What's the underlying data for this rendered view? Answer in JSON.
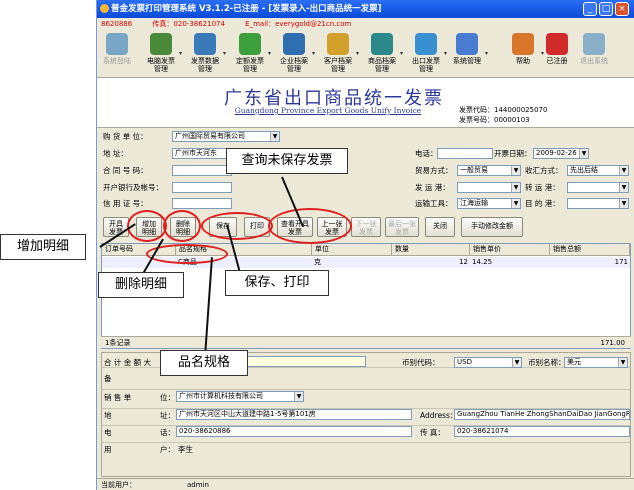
{
  "window": {
    "title": "普金发票打印管理系统 V3.1.2-已注册 - [发票录入-出口商品统一发票]",
    "info_phone": "8620886",
    "info_fax": "传真：020-38621074",
    "info_email": "E_mail：everygold@21cn.com"
  },
  "toolbar": {
    "items": [
      {
        "label": "系统登陆",
        "icon": "login-icon",
        "color": "#7aa7c7"
      },
      {
        "label": "电脑发票\n管理",
        "icon": "invoice-icon",
        "color": "#4a8a3a"
      },
      {
        "label": "发票数据\n管理",
        "icon": "data-icon",
        "color": "#3a7ab8"
      },
      {
        "label": "定额发票\n管理",
        "icon": "quota-icon",
        "color": "#3d9e3d"
      },
      {
        "label": "企业档案\n管理",
        "icon": "company-icon",
        "color": "#2f6fb0"
      },
      {
        "label": "客户档案\n管理",
        "icon": "customer-icon",
        "color": "#d2a12c"
      },
      {
        "label": "商品档案\n管理",
        "icon": "product-icon",
        "color": "#2d8a8a"
      },
      {
        "label": "出口发票\n管理",
        "icon": "export-icon",
        "color": "#3a8fd0"
      },
      {
        "label": "系统管理",
        "icon": "settings-icon",
        "color": "#4a7bd0"
      },
      {
        "label": "帮助",
        "icon": "help-icon",
        "color": "#d9762a"
      },
      {
        "label": "已注册",
        "icon": "registered-icon",
        "color": "#d02a2a"
      },
      {
        "label": "退出系统",
        "icon": "exit-icon",
        "color": "#8ab0c8"
      }
    ]
  },
  "banner": {
    "title": "广东省出口商品统一发票",
    "subtitle": "Guangdong Province Export Goods Unify Invoice",
    "code_label": "发票代码：",
    "code_value": "144000025070",
    "number_label": "发票号码：",
    "number_value": "00000103"
  },
  "buyer": {
    "name_label": "购 货 单 位：",
    "name_value": "广州国际贸易有限公司",
    "addr_label": "地        址：",
    "addr_value": "广州市天河东",
    "contract_label": "合 同 号 码：",
    "bank_label": "开户银行及帐号：",
    "credit_label": "信 用 证 号：",
    "phone_label": "电话：",
    "date_label": "开票日期：",
    "date_value": "2009-02-26",
    "trade_label": "贸易方式：",
    "trade_value": "一般贸易",
    "settle_label": "收汇方式：",
    "settle_value": "先出后结",
    "ship_from_label": "发 运 港：",
    "transfer_label": "转 运 港：",
    "transport_label": "运输工具：",
    "transport_value": "江海运输",
    "dest_label": "目 的 港："
  },
  "buttons": {
    "open": "开具\n发票",
    "add_detail": "增加\n明细",
    "delete_detail": "删除\n明细",
    "save": "保存",
    "print": "打印",
    "view_open": "查看开具\n发票",
    "prev": "上一张\n发票",
    "next": "下一张\n发票",
    "last": "最后一张\n发票",
    "close": "关闭",
    "manual_amount": "手动修改金额"
  },
  "grid": {
    "headers": [
      "订单号码",
      "品名规格",
      "单位",
      "数量",
      "销售单价",
      "销售总额"
    ],
    "rows": [
      {
        "order": "",
        "name": "C商品",
        "unit": "克",
        "qty": "12",
        "price": "14.25",
        "total": "171"
      }
    ],
    "record_count": "1条记录",
    "sum_total": "171.00"
  },
  "bottom": {
    "total_label": "合 计 金 额 大",
    "currency_code_label": "币别代码：",
    "currency_code_value": "USD",
    "currency_name_label": "币别名称：",
    "currency_name_value": "美元",
    "remark_label": "备",
    "seller_label": "销    售    单",
    "seller_label2": "位：",
    "seller_value": "广州市计算机科技有限公司",
    "addr_label": "地",
    "addr_label2": "址：",
    "addr_value": "广州市天河区中山大道建中路1-5号第101房",
    "address_label": "Address：",
    "address_value": "GuangZhou TianHe ZhongShanDaiDao JianGongRo",
    "phone_label": "电",
    "phone_label2": "话：",
    "phone_value": "020-38620886",
    "fax_label": "传    真：",
    "fax_value": "020-38621074",
    "user_label": "用",
    "user_label2": "户：",
    "user_value": "李生"
  },
  "status": {
    "current_user_label": "当前用户：",
    "current_user_value": "admin"
  },
  "callouts": {
    "add_detail": "增加明细",
    "delete_detail": "删除明细",
    "view_unsaved": "查询未保存发票",
    "save_print": "保存、打印",
    "product_spec": "品名规格"
  }
}
